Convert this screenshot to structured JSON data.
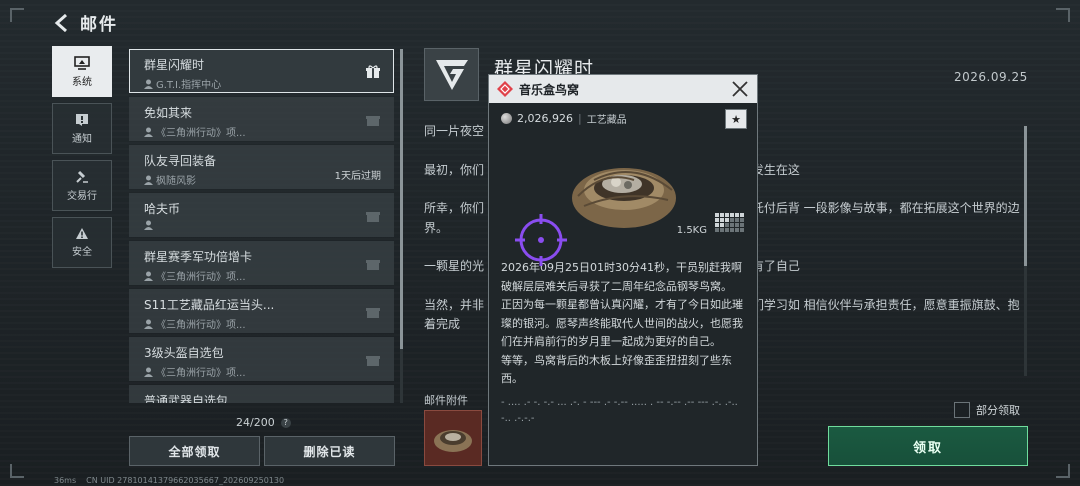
{
  "header": {
    "title": "邮件"
  },
  "nav": {
    "items": [
      {
        "label": "系统",
        "active": true,
        "icon": "system-icon"
      },
      {
        "label": "通知",
        "active": false,
        "icon": "notice-icon"
      },
      {
        "label": "交易行",
        "active": false,
        "icon": "gavel-icon"
      },
      {
        "label": "安全",
        "active": false,
        "icon": "warning-icon"
      }
    ]
  },
  "mail_list": {
    "items": [
      {
        "title": "群星闪耀时",
        "sender": "G.T.I.指挥中心",
        "active": true,
        "expire": ""
      },
      {
        "title": "免如其来",
        "sender": "《三角洲行动》项...",
        "active": false,
        "expire": ""
      },
      {
        "title": "队友寻回装备",
        "sender": "枫随风影",
        "active": false,
        "expire": "1天后过期"
      },
      {
        "title": "哈夫币",
        "sender": "",
        "active": false,
        "expire": ""
      },
      {
        "title": "群星赛季军功倍增卡",
        "sender": "《三角洲行动》项...",
        "active": false,
        "expire": ""
      },
      {
        "title": "S11工艺藏品红运当头...",
        "sender": "《三角洲行动》项...",
        "active": false,
        "expire": ""
      },
      {
        "title": "3级头盔自选包",
        "sender": "《三角洲行动》项...",
        "active": false,
        "expire": ""
      },
      {
        "title": "普通武器自选包",
        "sender": "",
        "active": false,
        "expire": ""
      }
    ],
    "count": "24/200",
    "help": "?",
    "claim_all_label": "全部领取",
    "delete_read_label": "删除已读"
  },
  "detail": {
    "title": "群星闪耀时",
    "date": "2026.09.25",
    "paragraphs": [
      "同一片夜空",
      "最初，你们                                                      ，以及一片黯淡无光的夜空，没有人能够预先写下发生在这",
      "所幸，你们                                                      藏武装，结成小队，在一次次并肩作战中成为可以托付后背                                                      一段影像与故事，都在拓展这个世界的边界。",
      "一颗星的光                                                      万颗这样的星彼此相遇，这个世界的夜空便终于拥有了自己",
      "当然，并非                                                      得答案，但正是在一次次跌倒和爬起的过程中，我们学习如                                                      相信伙伴与承担责任，愿意重振旗鼓、抱着完成"
    ],
    "attachment_label": "邮件附件",
    "partial_claim_label": "部分领取",
    "claim_label": "领取"
  },
  "tooltip": {
    "name": "音乐盒鸟窝",
    "price": "2,026,926",
    "category": "工艺藏品",
    "weight": "1.5KG",
    "description": "2026年09月25日01时30分41秒，干员别赶我啊破解层层难关后寻获了二周年纪念品钢琴鸟窝。\n正因为每一颗星都曾认真闪耀，才有了今日如此璀璨的银河。愿琴声终能取代人世间的战火，也愿我们在并肩前行的岁月里一起成为更好的自己。\n等等，鸟窝背后的木板上好像歪歪扭扭刻了些东西。",
    "morse": "- .... .- -. -.- ... .-. - --- .- -.-- ..... . -- -.-- .-- --- .-. .-.. -.. .-.-.-"
  },
  "status_bar": {
    "ping": "36ms",
    "uid": "CN UID 27810141379662035667_202609250130"
  },
  "colors": {
    "accent_green": "#6fdc9d",
    "rarity_red": "#e0424a",
    "crosshair": "#8a4df0"
  }
}
